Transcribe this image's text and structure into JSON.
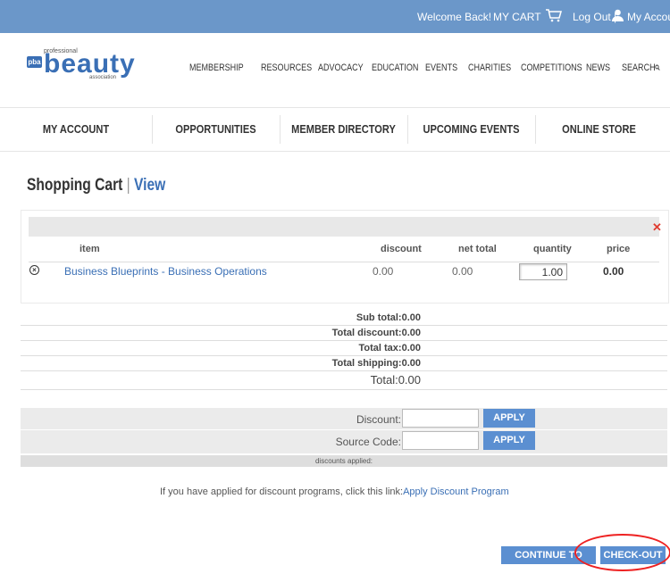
{
  "topbar": {
    "welcome": "Welcome Back!",
    "cart": "MY CART",
    "logout": "Log Out |",
    "account": "My Account"
  },
  "logo": {
    "small": "pba",
    "professional": "professional",
    "beauty": "beauty",
    "association": "association"
  },
  "mainnav": [
    "MEMBERSHIP",
    "RESOURCES",
    "ADVOCACY",
    "EDUCATION",
    "EVENTS",
    "CHARITIES",
    "COMPETITIONS",
    "NEWS",
    "SEARCH"
  ],
  "subnav": [
    "MY ACCOUNT",
    "OPPORTUNITIES",
    "MEMBER DIRECTORY",
    "UPCOMING EVENTS",
    "ONLINE STORE"
  ],
  "page": {
    "title": "Shopping Cart",
    "sep": "|",
    "view": "View"
  },
  "cart": {
    "headers": {
      "item": "item",
      "discount": "discount",
      "net_total": "net total",
      "quantity": "quantity",
      "price": "price"
    },
    "row": {
      "item": "Business Blueprints - Business Operations",
      "discount": "0.00",
      "net_total": "0.00",
      "quantity": "1.00",
      "price": "0.00"
    }
  },
  "totals": {
    "sub_total": "Sub total:0.00",
    "total_discount": "Total discount:0.00",
    "total_tax": "Total tax:0.00",
    "total_shipping": "Total shipping:0.00",
    "total": "Total:0.00"
  },
  "discount": {
    "discount_label": "Discount:",
    "source_label": "Source Code:",
    "apply": "APPLY",
    "applied": "discounts applied:"
  },
  "note": {
    "text": "If you have applied for discount programs, click this link:",
    "link": "Apply Discount Program"
  },
  "buttons": {
    "continue": "CONTINUE TO SHOP",
    "checkout": "CHECK-OUT"
  },
  "colors": {
    "topbar": "#6b97c9",
    "brand": "#3a6fb5",
    "button": "#5b8fd1",
    "highlight": "#e22222"
  }
}
